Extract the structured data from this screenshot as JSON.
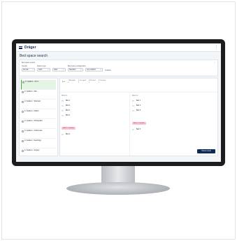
{
  "app": {
    "logo": "Dräger",
    "page_title": "Bed space search"
  },
  "filters": {
    "section_label": "Bed space search",
    "fields": [
      {
        "label": "Gender",
        "value": "Female"
      },
      {
        "label": "Patient type",
        "value": "Adult"
      },
      {
        "label": "",
        "value": "Adult"
      },
      {
        "label": "Bed space configuration",
        "value": "Standard"
      },
      {
        "label": "",
        "value": "Any isolation"
      }
    ],
    "checkbox_label": "Isolation"
  },
  "results": [
    {
      "text": "2. Inpatient · 2nd 1",
      "selected": true
    },
    {
      "text": "2. Inpatient · Stat",
      "selected": false
    },
    {
      "text": "2. Inpatient · Telemetry",
      "selected": false
    },
    {
      "text": "2. Inpatient · Station",
      "selected": false
    },
    {
      "text": "2. Inpatient · Orthopedics",
      "selected": false
    },
    {
      "text": "3. Inpatient · Critical care",
      "selected": false
    },
    {
      "text": "2. Inpatient · Neurology",
      "selected": false
    },
    {
      "text": "2. Inpatient · Surgery",
      "selected": false
    }
  ],
  "detail": {
    "header_cols": [
      {
        "label": "1 Available",
        "value": "4"
      },
      {
        "label": "2 Occupied",
        "value": "2"
      },
      {
        "label": "3 Blocked",
        "value": "1"
      },
      {
        "label": "4 Cleaning",
        "value": "1"
      }
    ],
    "left_room": {
      "title": "Room 1",
      "beds": [
        "Bed 1",
        "Bed 2",
        "Bed 3",
        "Bed 4"
      ],
      "chip": "Bed 5 · Isolation",
      "last_bed": "Bed 6"
    },
    "right_room": {
      "title": "Room 2",
      "beds": [
        "Bed 1",
        "Bed 2",
        "Bed 3"
      ],
      "chip": "Bed 4 · Isolation",
      "last_bed": "Bed 5"
    },
    "assign_label": "Show result"
  }
}
